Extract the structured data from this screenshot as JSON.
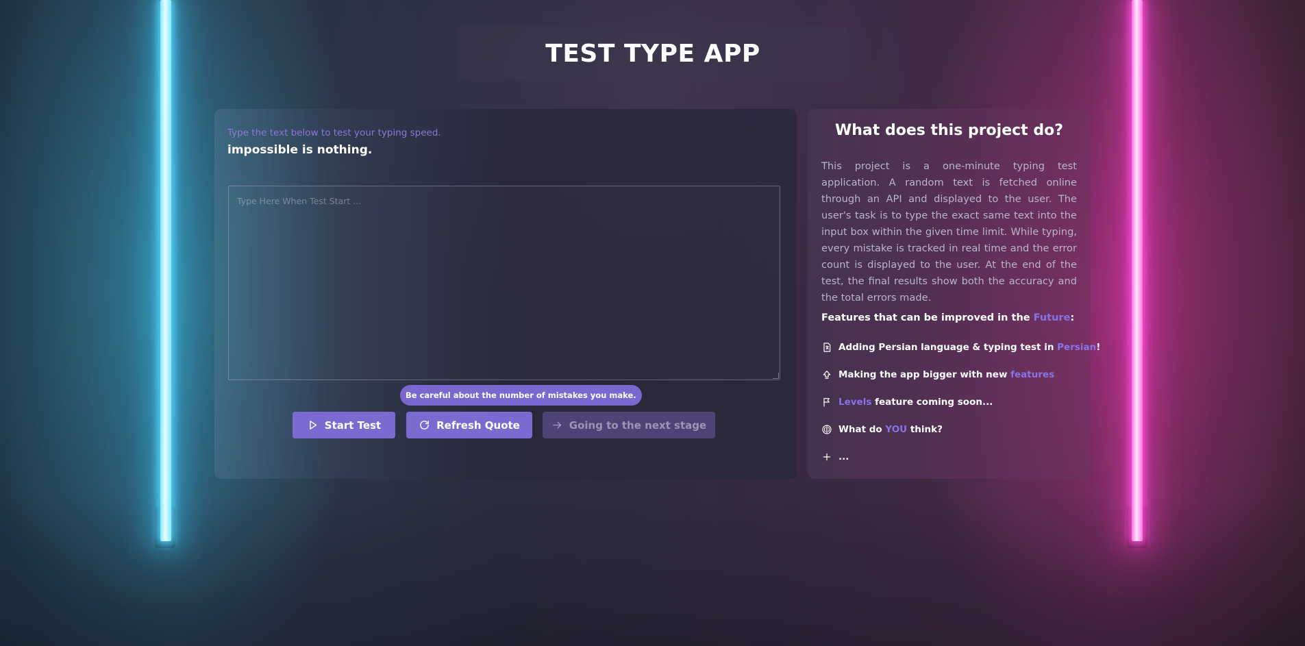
{
  "app": {
    "title": "TEST TYPE APP"
  },
  "typing_panel": {
    "hint": "Type the text below to test your typing speed.",
    "quote": "impossible is nothing.",
    "input_placeholder": "Type Here When Test Start ...",
    "input_value": "",
    "tooltip": "Be careful about the number of mistakes you make.",
    "buttons": {
      "start": "Start Test",
      "refresh": "Refresh Quote",
      "next": "Going to the next stage"
    }
  },
  "info_panel": {
    "heading": "What does this project do?",
    "description": "This project is a one-minute typing test application. A random text is fetched online through an API and displayed to the user. The user's task is to type the exact same text into the input box within the given time limit. While typing, every mistake is tracked in real time and the error count is displayed to the user. At the end of the test, the final results show both the accuracy and the total errors made.",
    "features_title": {
      "prefix": "Features that can be improved in the ",
      "accent": "Future",
      "suffix": ":"
    },
    "features": [
      {
        "icon": "translate-icon",
        "before": "Adding Persian language & typing test in ",
        "accent": "Persian",
        "after": "!"
      },
      {
        "icon": "arrow-up-icon",
        "before": "Making the app bigger with new ",
        "accent": "features",
        "after": ""
      },
      {
        "icon": "flag-icon",
        "before": "",
        "accent": "Levels",
        "after": " feature coming soon..."
      },
      {
        "icon": "brain-icon",
        "before": "What do ",
        "accent": "YOU",
        "after": " think?"
      },
      {
        "icon": "plus-icon",
        "before": "",
        "accent": "",
        "after": "..."
      }
    ]
  },
  "colors": {
    "accent": "#8a72e6",
    "button": "#7d6ad1",
    "neon_left": "#7fe9ff",
    "neon_right": "#ff6fe0"
  }
}
